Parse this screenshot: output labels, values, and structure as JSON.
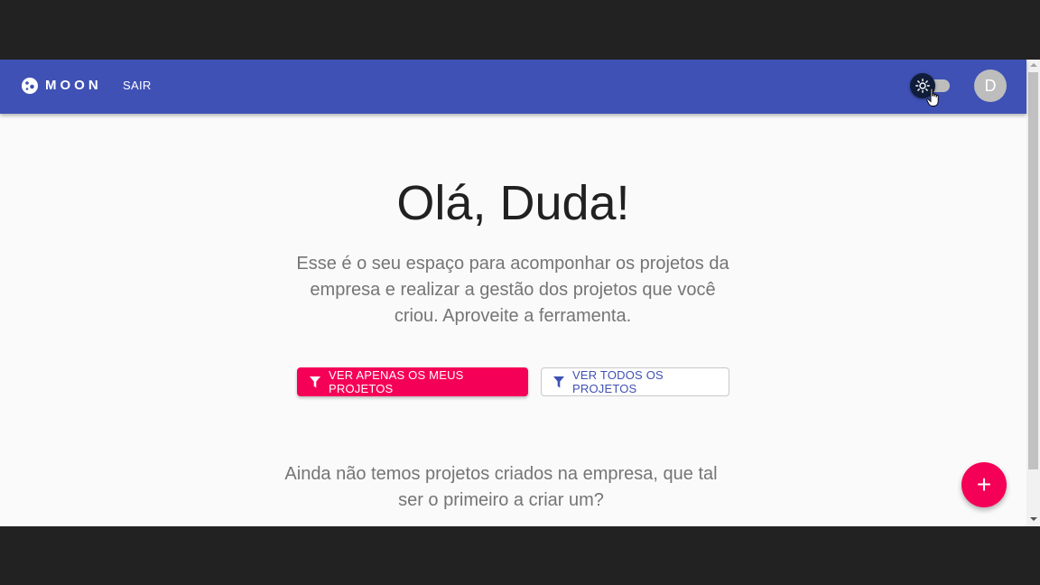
{
  "appbar": {
    "brand": "MOON",
    "logout_label": "SAIR",
    "avatar_initial": "D",
    "theme_icon": "sun-icon"
  },
  "hero": {
    "title": "Olá, Duda!",
    "subtitle": "Esse é o seu espaço para acomponhar os projetos da empresa e realizar a gestão dos projetos que você criou. Aproveite a ferramenta."
  },
  "filters": {
    "my_projects_label": "VER APENAS OS MEUS PROJETOS",
    "all_projects_label": "VER TODOS OS PROJETOS",
    "icon": "filter-icon"
  },
  "empty_state": {
    "message": "Ainda não temos projetos criados na empresa, que tal ser o primeiro a criar um?"
  },
  "fab": {
    "label": "+"
  },
  "colors": {
    "primary": "#3f51b5",
    "accent": "#f50057",
    "background": "#fafafa",
    "text_secondary": "#757575"
  }
}
